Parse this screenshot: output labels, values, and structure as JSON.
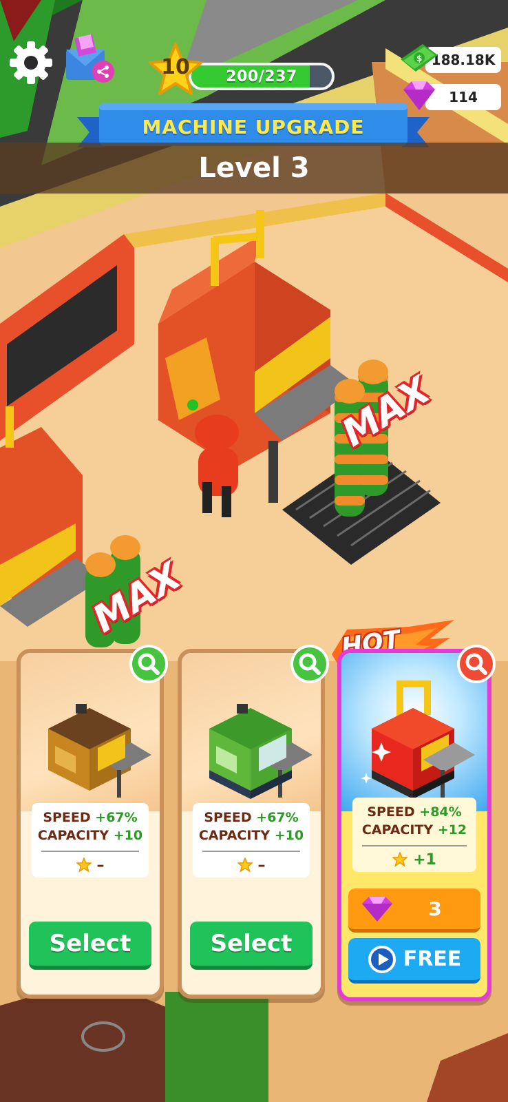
{
  "hud": {
    "player_level": "10",
    "xp_text": "200/237",
    "xp_progress": 0.844,
    "cash": "188.18K",
    "gems": "114"
  },
  "banner": {
    "title": "MACHINE UPGRADE",
    "level_label": "Level 3"
  },
  "scene": {
    "max_label": "MAX"
  },
  "cards": [
    {
      "machine_color": "#d99a2a",
      "speed_label": "SPEED",
      "speed_value": "+67%",
      "capacity_label": "CAPACITY",
      "capacity_value": "+10",
      "star_value": "–",
      "button_label": "Select"
    },
    {
      "machine_color": "#6cc63b",
      "speed_label": "SPEED",
      "speed_value": "+67%",
      "capacity_label": "CAPACITY",
      "capacity_value": "+10",
      "star_value": "–",
      "button_label": "Select"
    },
    {
      "badge": "HOT",
      "machine_color": "#e8281e",
      "speed_label": "SPEED",
      "speed_value": "+84%",
      "capacity_label": "CAPACITY",
      "capacity_value": "+12",
      "star_value": "+1",
      "gem_cost": "3",
      "free_label": "FREE"
    }
  ],
  "colors": {
    "select_green": "#1fc35a",
    "hot_border": "#e43ad7",
    "gem_orange": "#ff9a10",
    "free_blue": "#1eaaf2",
    "banner_blue": "#2f8ce8"
  },
  "icons": [
    "gear-icon",
    "mail-share-icon",
    "star-icon",
    "cash-icon",
    "gem-icon",
    "magnifier-icon",
    "play-icon"
  ]
}
